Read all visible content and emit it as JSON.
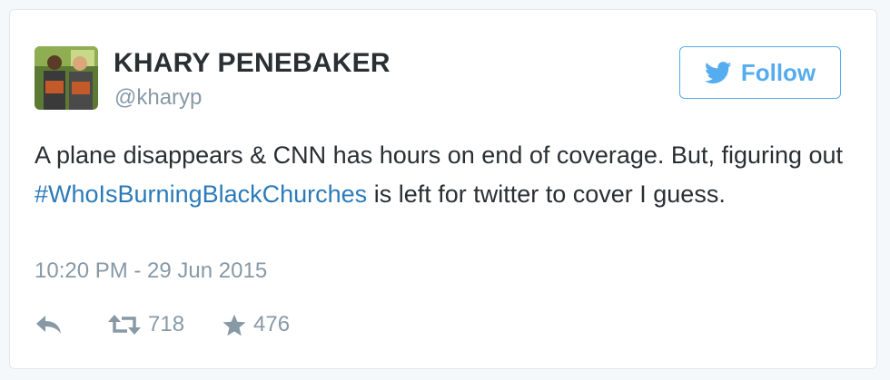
{
  "author": {
    "name": "KHARY PENEBAKER",
    "handle": "@kharyp"
  },
  "follow_button": {
    "label": "Follow",
    "icon": "twitter-bird-icon"
  },
  "tweet": {
    "text_before": "A plane disappears & CNN has hours on end of coverage. But, figuring out ",
    "hashtag": "#WhoIsBurningBlackChurches",
    "text_after": " is left for twitter to cover I guess.",
    "timestamp": "10:20 PM - 29 Jun 2015"
  },
  "actions": {
    "reply_icon": "reply-icon",
    "retweet_icon": "retweet-icon",
    "retweet_count": "718",
    "favorite_icon": "star-icon",
    "favorite_count": "476"
  },
  "colors": {
    "accent": "#55acee",
    "hashtag": "#2b7bb9",
    "text": "#292f33",
    "muted": "#8899a6",
    "border": "#e1e8ed"
  }
}
